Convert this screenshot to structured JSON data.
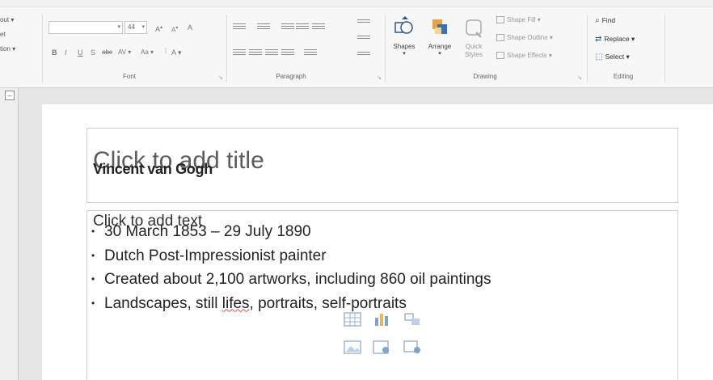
{
  "ribbon": {
    "left_cut_items": [
      "out",
      "et",
      "tion"
    ],
    "font_group": {
      "font_name": "",
      "font_size": "44",
      "grow_label": "A",
      "shrink_label": "A",
      "clear_label": "A",
      "bold": "B",
      "italic": "I",
      "underline": "U",
      "shadow": "S",
      "strike": "abc",
      "spacing": "AV",
      "case": "Aa",
      "color_label": "A",
      "label": "Font"
    },
    "paragraph_group": {
      "label": "Paragraph"
    },
    "drawing_group": {
      "shapes_label": "Shapes",
      "arrange_label": "Arrange",
      "quick_styles_label": "Quick Styles",
      "shape_fill": "Shape Fill",
      "shape_outline": "Shape Outline",
      "shape_effects": "Shape Effects",
      "label": "Drawing"
    },
    "editing_group": {
      "find": "Find",
      "replace": "Replace",
      "select": "Select",
      "label": "Editing"
    }
  },
  "slide": {
    "title_placeholder": "Click to add title",
    "title_text": "Vincent van Gogh",
    "content_placeholder": "Click to add text",
    "bullets": [
      "30 March 1853 – 29 July 1890",
      "Dutch Post-Impressionist painter",
      "Created about 2,100 artworks, including 860 oil paintings",
      "Landscapes, still lifes, portraits, self-portraits"
    ]
  },
  "colors": {
    "accent": "#2b5797",
    "slide_bg": "#ffffff",
    "workspace_bg": "#e6e6e6"
  }
}
